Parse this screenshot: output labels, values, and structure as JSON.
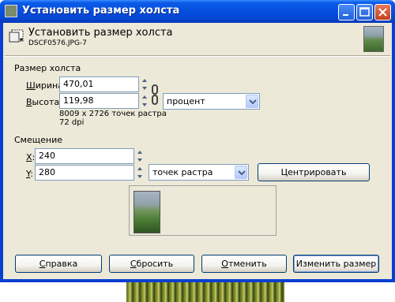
{
  "window": {
    "title": "Установить размер холста",
    "header_title": "Установить размер холста",
    "header_subtitle": "DSCF0576.JPG-7"
  },
  "canvas_size": {
    "section_label": "Размер холста",
    "width_label_u": "Ш",
    "width_label_rest": "ирина:",
    "width_value": "470,01",
    "height_label_u": "В",
    "height_label_rest": "ысота:",
    "height_value": "119,98",
    "unit_selected": "процент",
    "pixel_info": "8009 x 2726 точек растра",
    "dpi_info": "72 dpi"
  },
  "offset": {
    "section_label": "Смещение",
    "x_label_u": "X",
    "x_label_rest": ":",
    "x_value": "240",
    "y_label_u": "Y",
    "y_label_rest": ":",
    "y_value": "280",
    "unit_selected": "точек растра",
    "center_button": "Центрировать"
  },
  "buttons": {
    "help_u": "С",
    "help_rest": "правка",
    "reset_u": "С",
    "reset_rest": "бросить",
    "cancel_u": "О",
    "cancel_rest": "тменить",
    "resize": "Изменить размер"
  },
  "icons": {
    "title_icon": "gimp-canvas-icon",
    "header_icon": "canvas-size-icon",
    "minimize": "minimize-icon",
    "maximize": "maximize-icon",
    "close": "close-icon"
  }
}
